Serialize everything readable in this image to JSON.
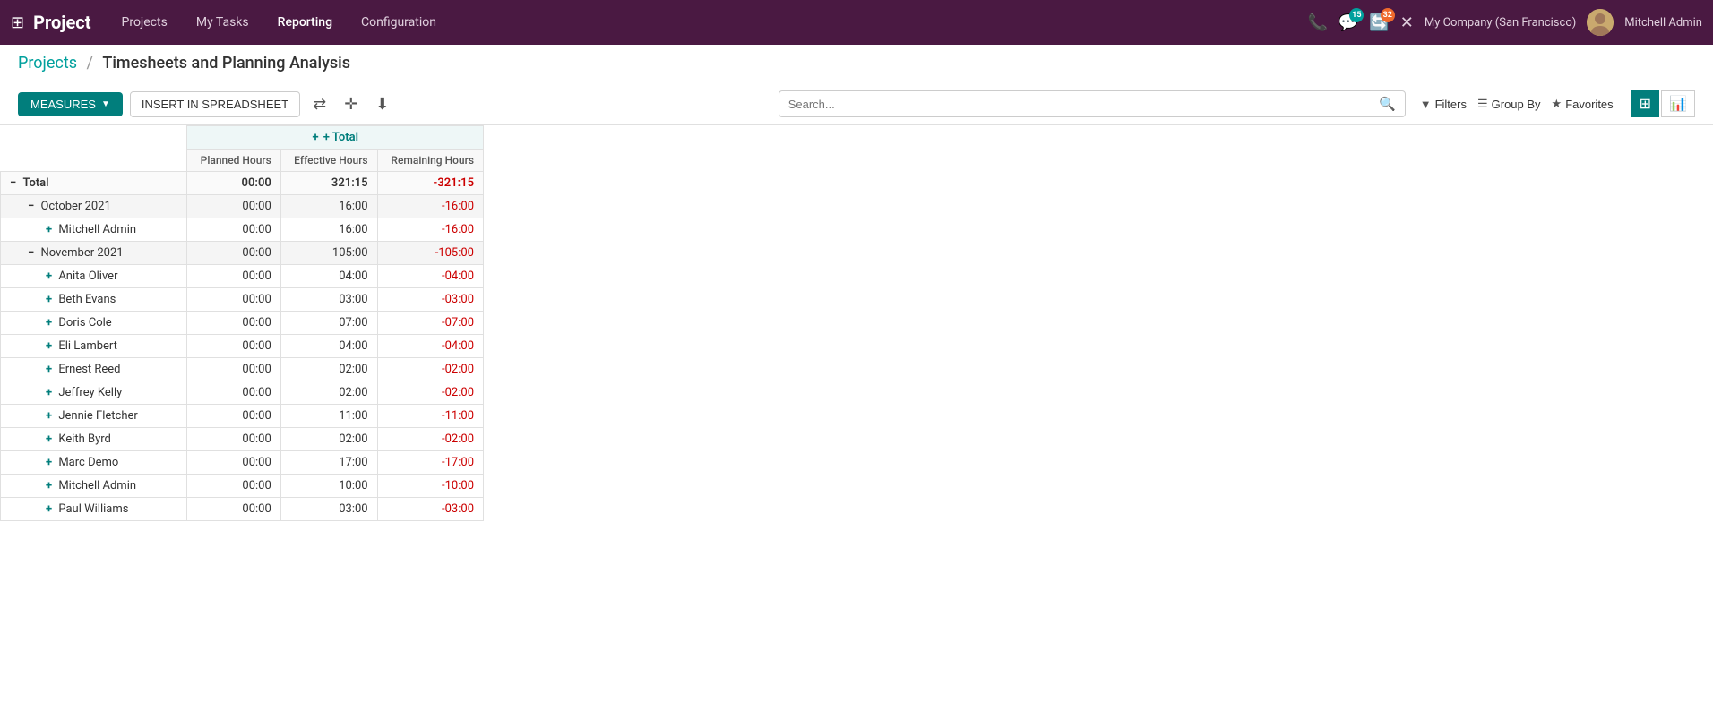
{
  "app": {
    "title": "Project"
  },
  "navbar": {
    "brand": "Project",
    "menu": [
      {
        "id": "projects",
        "label": "Projects",
        "active": false
      },
      {
        "id": "my-tasks",
        "label": "My Tasks",
        "active": false
      },
      {
        "id": "reporting",
        "label": "Reporting",
        "active": true
      },
      {
        "id": "configuration",
        "label": "Configuration",
        "active": false
      }
    ],
    "chat_badge": "15",
    "activity_badge": "32",
    "company": "My Company (San Francisco)",
    "username": "Mitchell Admin"
  },
  "breadcrumb": {
    "parent": "Projects",
    "separator": "/",
    "current": "Timesheets and Planning Analysis"
  },
  "toolbar": {
    "measures_label": "MEASURES",
    "insert_label": "INSERT IN SPREADSHEET"
  },
  "search": {
    "placeholder": "Search..."
  },
  "filters": {
    "filters_label": "Filters",
    "group_by_label": "Group By",
    "favorites_label": "Favorites"
  },
  "pivot": {
    "col_total_label": "+ Total",
    "columns": [
      {
        "id": "planned",
        "label": "Planned Hours"
      },
      {
        "id": "effective",
        "label": "Effective Hours"
      },
      {
        "id": "remaining",
        "label": "Remaining Hours"
      }
    ],
    "rows": [
      {
        "id": "total",
        "indent": 0,
        "icon": "minus",
        "label": "Total",
        "is_group": true,
        "is_total": true,
        "planned": "00:00",
        "effective": "321:15",
        "remaining": "-321:15"
      },
      {
        "id": "oct2021",
        "indent": 1,
        "icon": "minus",
        "label": "October 2021",
        "is_group": true,
        "planned": "00:00",
        "effective": "16:00",
        "remaining": "-16:00"
      },
      {
        "id": "oct-mitchell",
        "indent": 2,
        "icon": "plus",
        "label": "Mitchell Admin",
        "planned": "00:00",
        "effective": "16:00",
        "remaining": "-16:00"
      },
      {
        "id": "nov2021",
        "indent": 1,
        "icon": "minus",
        "label": "November 2021",
        "is_group": true,
        "planned": "00:00",
        "effective": "105:00",
        "remaining": "-105:00"
      },
      {
        "id": "nov-anita",
        "indent": 2,
        "icon": "plus",
        "label": "Anita Oliver",
        "planned": "00:00",
        "effective": "04:00",
        "remaining": "-04:00"
      },
      {
        "id": "nov-beth",
        "indent": 2,
        "icon": "plus",
        "label": "Beth Evans",
        "planned": "00:00",
        "effective": "03:00",
        "remaining": "-03:00"
      },
      {
        "id": "nov-doris",
        "indent": 2,
        "icon": "plus",
        "label": "Doris Cole",
        "planned": "00:00",
        "effective": "07:00",
        "remaining": "-07:00"
      },
      {
        "id": "nov-eli",
        "indent": 2,
        "icon": "plus",
        "label": "Eli Lambert",
        "planned": "00:00",
        "effective": "04:00",
        "remaining": "-04:00"
      },
      {
        "id": "nov-ernest",
        "indent": 2,
        "icon": "plus",
        "label": "Ernest Reed",
        "planned": "00:00",
        "effective": "02:00",
        "remaining": "-02:00"
      },
      {
        "id": "nov-jeffrey",
        "indent": 2,
        "icon": "plus",
        "label": "Jeffrey Kelly",
        "planned": "00:00",
        "effective": "02:00",
        "remaining": "-02:00"
      },
      {
        "id": "nov-jennie",
        "indent": 2,
        "icon": "plus",
        "label": "Jennie Fletcher",
        "planned": "00:00",
        "effective": "11:00",
        "remaining": "-11:00"
      },
      {
        "id": "nov-keith",
        "indent": 2,
        "icon": "plus",
        "label": "Keith Byrd",
        "planned": "00:00",
        "effective": "02:00",
        "remaining": "-02:00"
      },
      {
        "id": "nov-marc",
        "indent": 2,
        "icon": "plus",
        "label": "Marc Demo",
        "planned": "00:00",
        "effective": "17:00",
        "remaining": "-17:00"
      },
      {
        "id": "nov-mitchell",
        "indent": 2,
        "icon": "plus",
        "label": "Mitchell Admin",
        "planned": "00:00",
        "effective": "10:00",
        "remaining": "-10:00"
      },
      {
        "id": "nov-paul",
        "indent": 2,
        "icon": "plus",
        "label": "Paul Williams",
        "planned": "00:00",
        "effective": "03:00",
        "remaining": "-03:00"
      }
    ]
  }
}
